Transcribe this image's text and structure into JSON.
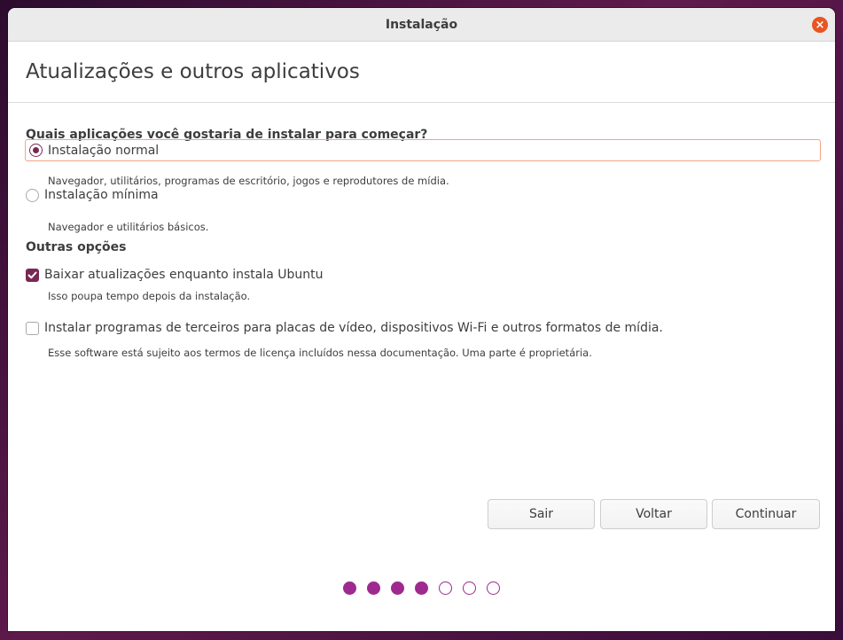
{
  "window": {
    "title": "Instalação"
  },
  "header": {
    "title": "Atualizações e outros aplicativos"
  },
  "install_type": {
    "question": "Quais aplicações você gostaria de instalar para começar?",
    "options": [
      {
        "label": "Instalação normal",
        "description": "Navegador, utilitários, programas de escritório, jogos e reprodutores de mídia.",
        "selected": true
      },
      {
        "label": "Instalação mínima",
        "description": "Navegador e utilitários básicos.",
        "selected": false
      }
    ]
  },
  "other_options": {
    "title": "Outras opções",
    "items": [
      {
        "label": "Baixar atualizações enquanto instala Ubuntu",
        "description": "Isso poupa tempo depois da instalação.",
        "checked": true
      },
      {
        "label": "Instalar programas de terceiros para placas de vídeo, dispositivos Wi-Fi e outros formatos de mídia.",
        "description": "Esse software está sujeito aos termos de licença incluídos nessa documentação. Uma parte é proprietária.",
        "checked": false
      }
    ]
  },
  "buttons": {
    "quit": "Sair",
    "back": "Voltar",
    "continue": "Continuar"
  },
  "progress": {
    "total_steps": 7,
    "completed_steps": 4
  },
  "colors": {
    "accent": "#772953",
    "close": "#e95420",
    "step": "#9e2a8f",
    "focus": "#f2a583"
  },
  "icons": {
    "close": "close-icon",
    "radio_selected": "radio-selected-icon",
    "checkbox_checked": "checkmark-icon"
  }
}
